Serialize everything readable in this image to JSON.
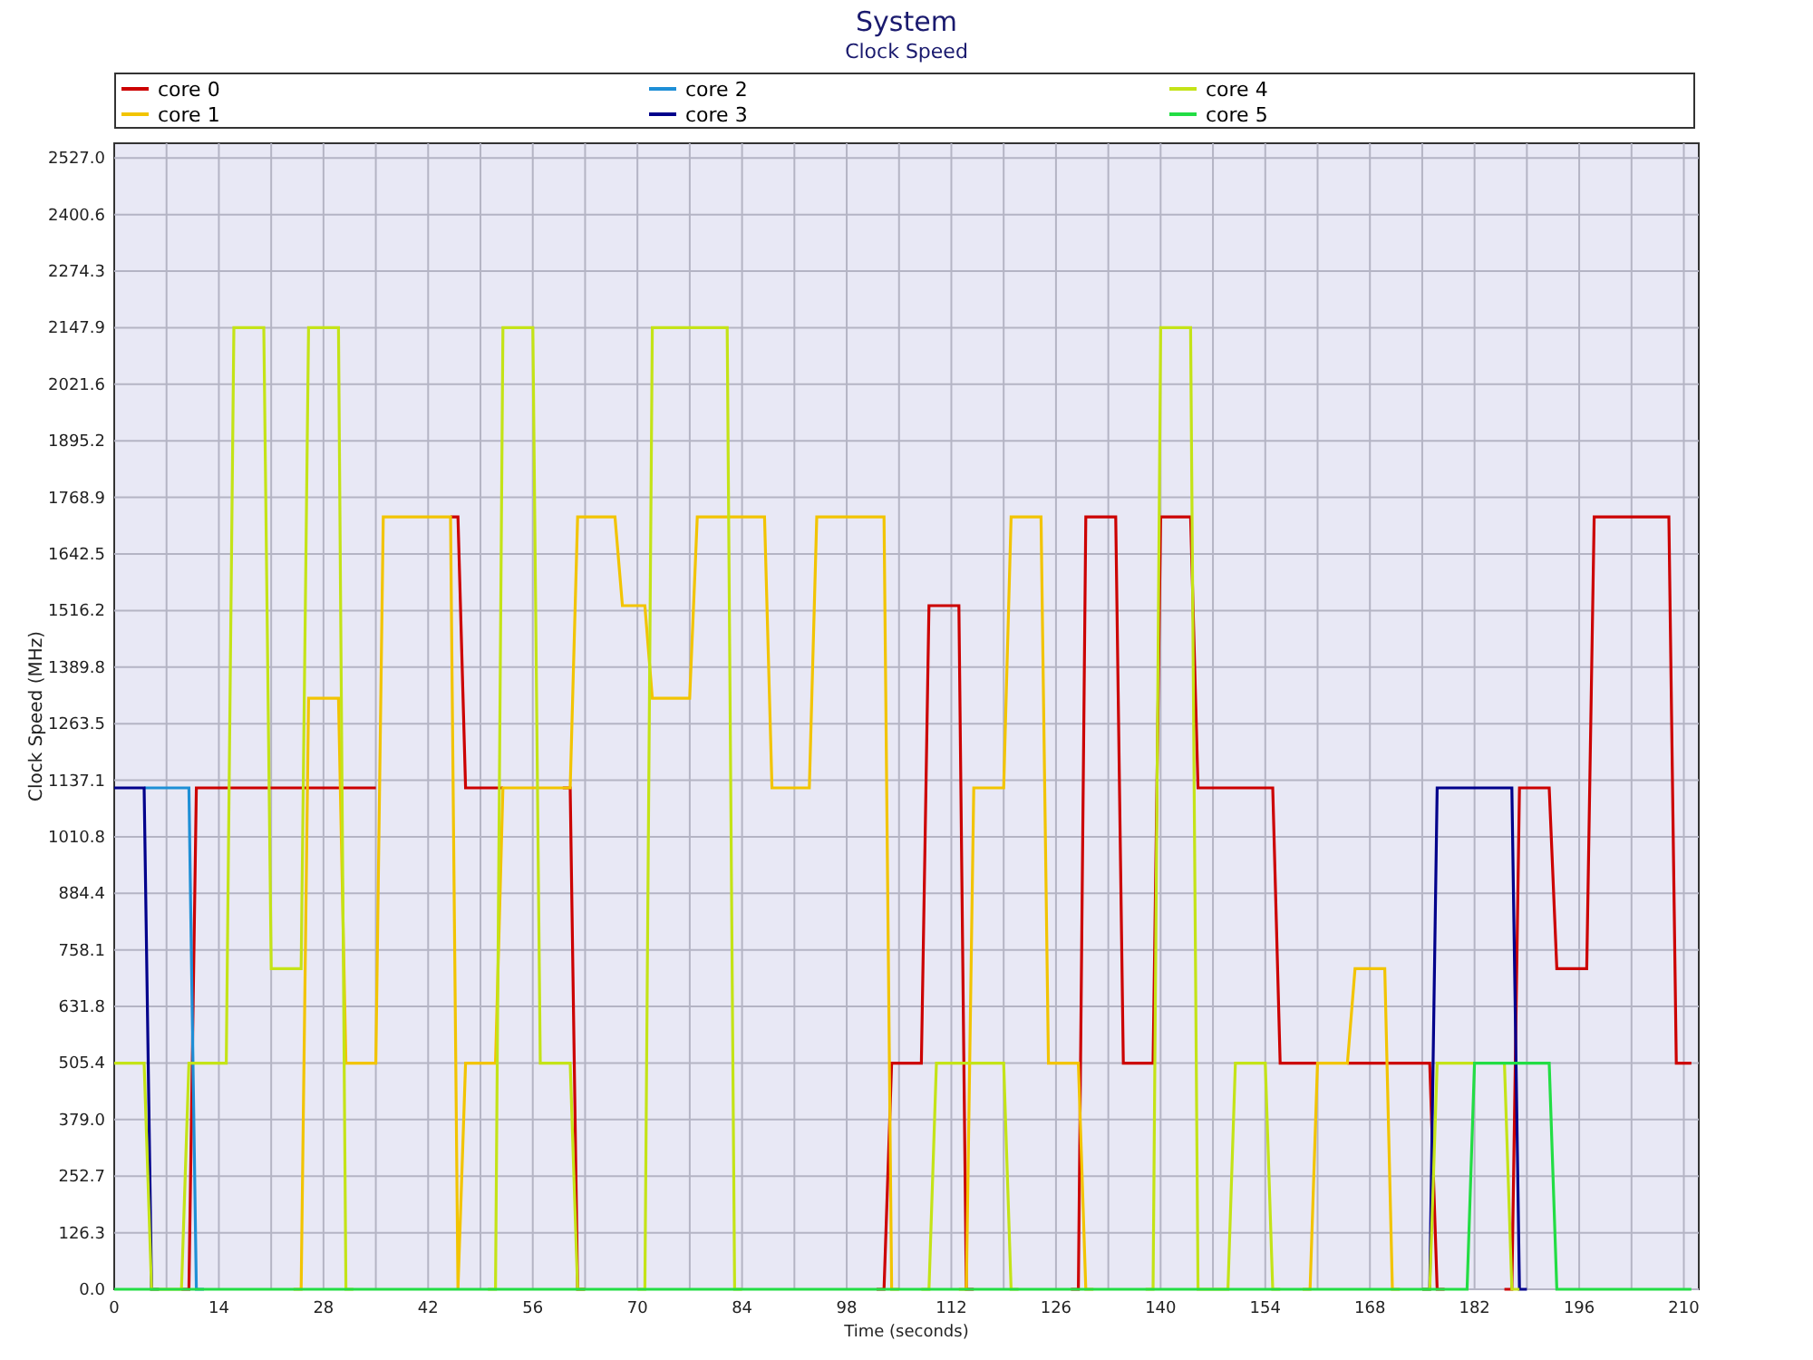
{
  "chart": {
    "title": "System",
    "subtitle": "Clock Speed",
    "chart_data": {
      "type": "line",
      "grid": true,
      "xlabel": "Time (seconds)",
      "ylabel": "Clock Speed (MHz)",
      "xlim": [
        0,
        212
      ],
      "ylim": [
        0,
        2560
      ],
      "xticks": [
        0,
        14,
        28,
        42,
        56,
        70,
        84,
        98,
        112,
        126,
        140,
        154,
        168,
        182,
        196,
        210
      ],
      "yticks": [
        {
          "value": 0,
          "label": "0.0"
        },
        {
          "value": 126.3,
          "label": "126.3"
        },
        {
          "value": 252.7,
          "label": "252.7"
        },
        {
          "value": 379,
          "label": "379.0"
        },
        {
          "value": 505.4,
          "label": "505.4"
        },
        {
          "value": 631.8,
          "label": "631.8"
        },
        {
          "value": 758.1,
          "label": "758.1"
        },
        {
          "value": 884.4,
          "label": "884.4"
        },
        {
          "value": 1010.8,
          "label": "1010.8"
        },
        {
          "value": 1137.1,
          "label": "1137.1"
        },
        {
          "value": 1263.5,
          "label": "1263.5"
        },
        {
          "value": 1389.8,
          "label": "1389.8"
        },
        {
          "value": 1516.2,
          "label": "1516.2"
        },
        {
          "value": 1642.5,
          "label": "1642.5"
        },
        {
          "value": 1768.9,
          "label": "1768.9"
        },
        {
          "value": 1895.2,
          "label": "1895.2"
        },
        {
          "value": 2021.6,
          "label": "2021.6"
        },
        {
          "value": 2147.9,
          "label": "2147.9"
        },
        {
          "value": 2274.3,
          "label": "2274.3"
        },
        {
          "value": 2400.6,
          "label": "2400.6"
        },
        {
          "value": 2527,
          "label": "2527.0"
        }
      ],
      "x": [
        0,
        1,
        2,
        3,
        4,
        5,
        6,
        7,
        8,
        9,
        10,
        11,
        12,
        13,
        14,
        15,
        16,
        17,
        18,
        19,
        20,
        21,
        22,
        23,
        24,
        25,
        26,
        27,
        28,
        29,
        30,
        31,
        32,
        33,
        34,
        35,
        36,
        37,
        38,
        39,
        40,
        41,
        42,
        43,
        44,
        45,
        46,
        47,
        48,
        49,
        50,
        51,
        52,
        53,
        54,
        55,
        56,
        57,
        58,
        59,
        60,
        61,
        62,
        63,
        64,
        65,
        66,
        67,
        68,
        69,
        70,
        71,
        72,
        73,
        74,
        75,
        76,
        77,
        78,
        79,
        80,
        81,
        82,
        83,
        84,
        85,
        86,
        87,
        88,
        89,
        90,
        91,
        92,
        93,
        94,
        95,
        96,
        97,
        98,
        99,
        100,
        101,
        102,
        103,
        104,
        105,
        106,
        107,
        108,
        109,
        110,
        111,
        112,
        113,
        114,
        115,
        116,
        117,
        118,
        119,
        120,
        121,
        122,
        123,
        124,
        125,
        126,
        127,
        128,
        129,
        130,
        131,
        132,
        133,
        134,
        135,
        136,
        137,
        138,
        139,
        140,
        141,
        142,
        143,
        144,
        145,
        146,
        147,
        148,
        149,
        150,
        151,
        152,
        153,
        154,
        155,
        156,
        157,
        158,
        159,
        160,
        161,
        162,
        163,
        164,
        165,
        166,
        167,
        168,
        169,
        170,
        171,
        172,
        173,
        174,
        175,
        176,
        177,
        178,
        179,
        180,
        181,
        182,
        183,
        184,
        185,
        186,
        187,
        188,
        189,
        190,
        191,
        192,
        193,
        194,
        195,
        196,
        197,
        198,
        199,
        200,
        201,
        202,
        203,
        204,
        205,
        206,
        207,
        208,
        209,
        210,
        211
      ],
      "series": [
        {
          "name": "core 0",
          "color": "#cc0000",
          "values": [
            null,
            null,
            null,
            null,
            null,
            null,
            null,
            null,
            null,
            0,
            0,
            1120,
            1120,
            1120,
            1120,
            1120,
            1120,
            1120,
            1120,
            1120,
            1120,
            1120,
            1120,
            1120,
            1120,
            1120,
            1120,
            1120,
            1120,
            1120,
            1120,
            1120,
            1120,
            1120,
            1120,
            1120,
            null,
            null,
            null,
            null,
            null,
            null,
            null,
            null,
            null,
            1725,
            1725,
            1120,
            1120,
            1120,
            1120,
            1120,
            1120,
            null,
            null,
            null,
            null,
            null,
            null,
            null,
            1120,
            1120,
            0,
            0,
            null,
            null,
            null,
            null,
            null,
            null,
            null,
            null,
            null,
            null,
            null,
            null,
            null,
            null,
            null,
            null,
            null,
            null,
            null,
            null,
            null,
            null,
            null,
            null,
            null,
            null,
            null,
            null,
            null,
            null,
            null,
            null,
            null,
            null,
            null,
            null,
            null,
            null,
            0,
            0,
            505,
            505,
            505,
            505,
            505,
            1527,
            1527,
            1527,
            1527,
            1527,
            0,
            0,
            null,
            null,
            null,
            null,
            null,
            null,
            null,
            null,
            null,
            null,
            null,
            null,
            0,
            0,
            1725,
            1725,
            1725,
            1725,
            1725,
            505,
            505,
            505,
            505,
            505,
            1725,
            1725,
            1725,
            1725,
            1725,
            1120,
            1120,
            1120,
            1120,
            1120,
            1120,
            1120,
            1120,
            1120,
            1120,
            1120,
            505,
            505,
            505,
            505,
            505,
            505,
            null,
            null,
            null,
            505,
            505,
            505,
            505,
            505,
            505,
            505,
            505,
            505,
            505,
            505,
            505,
            0,
            0,
            null,
            null,
            null,
            null,
            null,
            null,
            null,
            0,
            0,
            1120,
            1120,
            1120,
            1120,
            1120,
            716,
            716,
            716,
            716,
            716,
            1725,
            1725,
            1725,
            1725,
            1725,
            1725,
            1725,
            1725,
            1725,
            1725,
            1725,
            505,
            505,
            505
          ]
        },
        {
          "name": "core 1",
          "color": "#f2c400",
          "values": [
            null,
            null,
            null,
            null,
            null,
            null,
            null,
            null,
            null,
            null,
            null,
            null,
            null,
            null,
            null,
            null,
            null,
            null,
            null,
            null,
            null,
            null,
            null,
            null,
            0,
            0,
            1320,
            1320,
            1320,
            1320,
            1320,
            505,
            505,
            505,
            505,
            505,
            1725,
            1725,
            1725,
            1725,
            1725,
            1725,
            1725,
            1725,
            1725,
            1725,
            0,
            505,
            505,
            505,
            505,
            505,
            1120,
            1120,
            1120,
            1120,
            1120,
            1120,
            1120,
            1120,
            1120,
            1120,
            1725,
            1725,
            1725,
            1725,
            1725,
            1725,
            1527,
            1527,
            1527,
            1527,
            1320,
            1320,
            1320,
            1320,
            1320,
            1320,
            1725,
            1725,
            1725,
            1725,
            1725,
            1725,
            1725,
            1725,
            1725,
            1725,
            1120,
            1120,
            1120,
            1120,
            1120,
            1120,
            1725,
            1725,
            1725,
            1725,
            1725,
            1725,
            1725,
            1725,
            1725,
            1725,
            0,
            0,
            null,
            null,
            null,
            null,
            null,
            null,
            null,
            0,
            0,
            1120,
            1120,
            1120,
            1120,
            1120,
            1725,
            1725,
            1725,
            1725,
            1725,
            505,
            505,
            505,
            505,
            505,
            0,
            0,
            null,
            null,
            null,
            null,
            null,
            null,
            null,
            null,
            null,
            null,
            null,
            null,
            null,
            null,
            null,
            null,
            null,
            null,
            null,
            null,
            null,
            null,
            null,
            null,
            null,
            null,
            null,
            0,
            0,
            505,
            505,
            505,
            505,
            505,
            716,
            716,
            716,
            716,
            716,
            0,
            0,
            null,
            null,
            null,
            null,
            null,
            null,
            null,
            null,
            null,
            null,
            null,
            null,
            null,
            null,
            null,
            null,
            null,
            null,
            null,
            null,
            null,
            null,
            null,
            null,
            null,
            null,
            null,
            null,
            null,
            null,
            null,
            null,
            null,
            null,
            null,
            null,
            null,
            null,
            null
          ]
        },
        {
          "name": "core 2",
          "color": "#1e8fd6",
          "values": [
            null,
            null,
            null,
            null,
            1120,
            1120,
            1120,
            1120,
            1120,
            1120,
            1120,
            0,
            0,
            null,
            null,
            null,
            null,
            null,
            null,
            null,
            null,
            null,
            null,
            null,
            null,
            null,
            null,
            null,
            null,
            null,
            null,
            null,
            null,
            null,
            null,
            null,
            null,
            null,
            null,
            null,
            null,
            null,
            null,
            null,
            null,
            null,
            null,
            null,
            null,
            null,
            null,
            null,
            null,
            null,
            null,
            null,
            null,
            null,
            null,
            null,
            null,
            null,
            null,
            null,
            null,
            null,
            null,
            null,
            null,
            null,
            null,
            null,
            null,
            null,
            null,
            null,
            null,
            null,
            null,
            null,
            null,
            null,
            null,
            null,
            null,
            null,
            null,
            null,
            null,
            null,
            null,
            null,
            null,
            null,
            null,
            null,
            null,
            null,
            null,
            null,
            null,
            null,
            null,
            null,
            null,
            null,
            null,
            null,
            null,
            null,
            null,
            null,
            null,
            null,
            null,
            null,
            null,
            null,
            null,
            null,
            null,
            null,
            null,
            null,
            null,
            null,
            null,
            null,
            null,
            null,
            null,
            null,
            null,
            null,
            null,
            null,
            null,
            null,
            null,
            null,
            null,
            null,
            null,
            null,
            null,
            null,
            null,
            null,
            null,
            null,
            null,
            null,
            null,
            null,
            null,
            null,
            null,
            null,
            null,
            null,
            null,
            null,
            null,
            null,
            null,
            null,
            null,
            null,
            null,
            null,
            null,
            null,
            null,
            null,
            null,
            null,
            null,
            null,
            null,
            null,
            null,
            null,
            null,
            null,
            null,
            null,
            null,
            null,
            null,
            null,
            null,
            null,
            null,
            null,
            null,
            null,
            null,
            null,
            null,
            null,
            null,
            null,
            null,
            null,
            null,
            null,
            null,
            null,
            null,
            null,
            null,
            null
          ]
        },
        {
          "name": "core 3",
          "color": "#00008b",
          "values": [
            1120,
            1120,
            1120,
            1120,
            1120,
            0,
            0,
            null,
            null,
            null,
            null,
            null,
            null,
            null,
            null,
            null,
            null,
            null,
            null,
            null,
            null,
            null,
            null,
            null,
            null,
            null,
            null,
            null,
            null,
            null,
            null,
            null,
            null,
            null,
            null,
            null,
            null,
            null,
            null,
            null,
            null,
            null,
            null,
            null,
            null,
            null,
            null,
            null,
            null,
            null,
            null,
            null,
            null,
            null,
            null,
            null,
            null,
            null,
            null,
            null,
            null,
            null,
            null,
            null,
            null,
            null,
            null,
            null,
            null,
            null,
            null,
            null,
            null,
            null,
            null,
            null,
            null,
            null,
            null,
            null,
            null,
            null,
            null,
            null,
            null,
            null,
            null,
            null,
            null,
            null,
            null,
            null,
            null,
            null,
            null,
            null,
            null,
            null,
            null,
            null,
            null,
            null,
            null,
            null,
            null,
            null,
            null,
            null,
            null,
            null,
            null,
            null,
            null,
            null,
            null,
            null,
            null,
            null,
            null,
            null,
            null,
            null,
            null,
            null,
            null,
            null,
            null,
            null,
            null,
            null,
            null,
            null,
            null,
            null,
            null,
            null,
            null,
            null,
            null,
            null,
            null,
            null,
            null,
            null,
            null,
            null,
            null,
            null,
            null,
            null,
            null,
            null,
            null,
            null,
            null,
            null,
            null,
            null,
            null,
            null,
            null,
            null,
            null,
            null,
            null,
            null,
            null,
            null,
            null,
            null,
            null,
            null,
            null,
            null,
            null,
            0,
            0,
            1120,
            1120,
            1120,
            1120,
            1120,
            1120,
            1120,
            1120,
            1120,
            1120,
            1120,
            0,
            0,
            null,
            null,
            null,
            null,
            null,
            null,
            null,
            null,
            null,
            null,
            null,
            null,
            null,
            null,
            null,
            null,
            null,
            null,
            null,
            null,
            null,
            null
          ]
        },
        {
          "name": "core 4",
          "color": "#c4e317",
          "values": [
            505,
            505,
            505,
            505,
            505,
            0,
            0,
            0,
            0,
            0,
            505,
            505,
            505,
            505,
            505,
            505,
            2148,
            2148,
            2148,
            2148,
            2148,
            716,
            716,
            716,
            716,
            716,
            2148,
            2148,
            2148,
            2148,
            2148,
            0,
            0,
            null,
            null,
            null,
            null,
            null,
            null,
            null,
            null,
            null,
            null,
            null,
            null,
            null,
            null,
            null,
            null,
            null,
            0,
            0,
            2148,
            2148,
            2148,
            2148,
            2148,
            505,
            505,
            505,
            505,
            505,
            0,
            0,
            null,
            null,
            null,
            null,
            null,
            null,
            0,
            0,
            2148,
            2148,
            2148,
            2148,
            2148,
            2148,
            2148,
            2148,
            2148,
            2148,
            2148,
            0,
            0,
            null,
            null,
            null,
            null,
            null,
            null,
            null,
            null,
            null,
            null,
            null,
            null,
            null,
            null,
            null,
            null,
            null,
            null,
            null,
            null,
            null,
            null,
            null,
            0,
            0,
            505,
            505,
            505,
            505,
            505,
            505,
            505,
            505,
            505,
            505,
            0,
            0,
            null,
            null,
            null,
            null,
            null,
            null,
            null,
            null,
            null,
            null,
            null,
            null,
            null,
            null,
            null,
            null,
            0,
            0,
            2148,
            2148,
            2148,
            2148,
            2148,
            0,
            0,
            0,
            0,
            0,
            505,
            505,
            505,
            505,
            505,
            0,
            0,
            null,
            null,
            null,
            null,
            null,
            null,
            null,
            null,
            null,
            null,
            null,
            null,
            null,
            null,
            null,
            null,
            null,
            null,
            0,
            0,
            505,
            505,
            505,
            505,
            505,
            505,
            null,
            null,
            null,
            505,
            0,
            0,
            null,
            null,
            null,
            null,
            null,
            null,
            null,
            null,
            null,
            null,
            null,
            null,
            null,
            null,
            null,
            null,
            null,
            null,
            null,
            null,
            null,
            null,
            null
          ]
        },
        {
          "name": "core 5",
          "color": "#22dd44",
          "values": [
            0,
            0,
            0,
            0,
            0,
            0,
            0,
            0,
            0,
            0,
            0,
            0,
            0,
            0,
            0,
            0,
            0,
            0,
            0,
            0,
            0,
            0,
            0,
            0,
            0,
            0,
            0,
            0,
            0,
            0,
            0,
            0,
            0,
            0,
            0,
            0,
            0,
            0,
            0,
            0,
            0,
            0,
            0,
            0,
            0,
            0,
            0,
            0,
            0,
            0,
            0,
            0,
            0,
            0,
            0,
            0,
            0,
            0,
            0,
            0,
            0,
            0,
            0,
            0,
            0,
            0,
            0,
            0,
            0,
            0,
            0,
            0,
            0,
            0,
            0,
            0,
            0,
            0,
            0,
            0,
            0,
            0,
            0,
            0,
            0,
            0,
            0,
            0,
            0,
            0,
            0,
            0,
            0,
            0,
            0,
            0,
            0,
            0,
            0,
            0,
            0,
            0,
            0,
            0,
            0,
            0,
            0,
            0,
            0,
            0,
            0,
            0,
            0,
            0,
            0,
            0,
            0,
            0,
            0,
            0,
            0,
            0,
            0,
            0,
            0,
            0,
            0,
            0,
            0,
            0,
            0,
            0,
            0,
            0,
            0,
            0,
            0,
            0,
            0,
            0,
            0,
            0,
            0,
            0,
            0,
            0,
            0,
            0,
            0,
            0,
            0,
            0,
            0,
            0,
            0,
            0,
            0,
            0,
            0,
            0,
            0,
            0,
            0,
            0,
            0,
            0,
            0,
            0,
            0,
            0,
            0,
            0,
            0,
            0,
            0,
            0,
            0,
            0,
            0,
            0,
            0,
            0,
            505,
            505,
            505,
            505,
            505,
            505,
            505,
            505,
            505,
            505,
            505,
            0,
            0,
            0,
            0,
            0,
            0,
            0,
            0,
            0,
            0,
            0,
            0,
            0,
            0,
            0,
            0,
            0,
            0,
            0
          ]
        }
      ]
    }
  }
}
